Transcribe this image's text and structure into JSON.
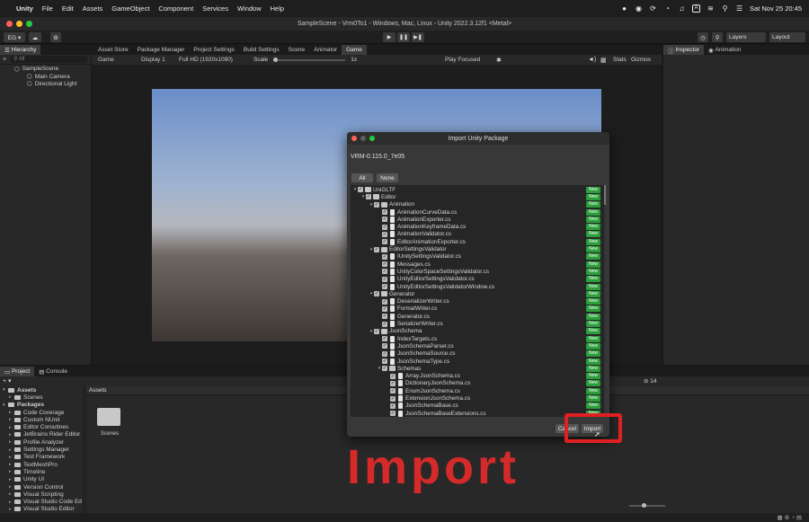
{
  "menubar": {
    "apple": "",
    "items": [
      "Unity",
      "File",
      "Edit",
      "Assets",
      "GameObject",
      "Component",
      "Services",
      "Window",
      "Help"
    ],
    "status_box_label": "A",
    "datetime": "Sat Nov 25  20:45"
  },
  "window": {
    "title": "SampleScene - Vrm0To1 - Windows, Mac, Linux - Unity 2022.3.12f1 <Metal>"
  },
  "toolbar": {
    "account": "EG ▾",
    "layers": "Layers",
    "layout": "Layout"
  },
  "hierarchy": {
    "tab": "Hierarchy",
    "search": "All",
    "scene": "SampleScene",
    "objects": [
      "Main Camera",
      "Directional Light"
    ]
  },
  "center_tabs": [
    "Asset Store",
    "Package Manager",
    "Project Settings",
    "Build Settings",
    "Scene",
    "Animator",
    "Game"
  ],
  "game_bar": {
    "mode": "Game",
    "display": "Display 1",
    "resolution": "Full HD (1920x1080)",
    "scale_label": "Scale",
    "scale_value": "1x",
    "play_mode": "Play Focused",
    "stats": "Stats",
    "gizmos": "Gizmos"
  },
  "right_tabs": [
    "Inspector",
    "Animation"
  ],
  "project": {
    "tabs": [
      "Project",
      "Console"
    ],
    "tree": [
      {
        "label": "Assets",
        "level": 0,
        "bold": true,
        "folder": true
      },
      {
        "label": "Scenes",
        "level": 1,
        "bold": false,
        "folder": true
      },
      {
        "label": "Packages",
        "level": 0,
        "bold": true,
        "folder": true
      },
      {
        "label": "Code Coverage",
        "level": 1,
        "bold": false,
        "folder": true
      },
      {
        "label": "Custom NUnit",
        "level": 1,
        "bold": false,
        "folder": true
      },
      {
        "label": "Editor Coroutines",
        "level": 1,
        "bold": false,
        "folder": true
      },
      {
        "label": "JetBrains Rider Editor",
        "level": 1,
        "bold": false,
        "folder": true
      },
      {
        "label": "Profile Analyzer",
        "level": 1,
        "bold": false,
        "folder": true
      },
      {
        "label": "Settings Manager",
        "level": 1,
        "bold": false,
        "folder": true
      },
      {
        "label": "Test Framework",
        "level": 1,
        "bold": false,
        "folder": true
      },
      {
        "label": "TextMeshPro",
        "level": 1,
        "bold": false,
        "folder": true
      },
      {
        "label": "Timeline",
        "level": 1,
        "bold": false,
        "folder": true
      },
      {
        "label": "Unity UI",
        "level": 1,
        "bold": false,
        "folder": true
      },
      {
        "label": "Version Control",
        "level": 1,
        "bold": false,
        "folder": true
      },
      {
        "label": "Visual Scripting",
        "level": 1,
        "bold": false,
        "folder": true
      },
      {
        "label": "Visual Studio Code Ed",
        "level": 1,
        "bold": false,
        "folder": true
      },
      {
        "label": "Visual Studio Editor",
        "level": 1,
        "bold": false,
        "folder": true
      }
    ],
    "breadcrumb": "Assets",
    "folder_item": "Scenes",
    "count": "14"
  },
  "dialog": {
    "title": "Import Unity Package",
    "package": "VRM-0.115.0_7e05",
    "all_label": "All",
    "none_label": "None",
    "new_badge": "New",
    "cancel_label": "Cancel",
    "import_label": "Import",
    "files": [
      {
        "name": "UniGLTF",
        "indent": 0,
        "folder": true,
        "expand": true
      },
      {
        "name": "Editor",
        "indent": 1,
        "folder": true,
        "expand": true
      },
      {
        "name": "Animation",
        "indent": 2,
        "folder": true,
        "expand": true
      },
      {
        "name": "AnimationCurveData.cs",
        "indent": 3,
        "folder": false,
        "expand": false
      },
      {
        "name": "AnimationExporter.cs",
        "indent": 3,
        "folder": false,
        "expand": false
      },
      {
        "name": "AnimationKeyframeData.cs",
        "indent": 3,
        "folder": false,
        "expand": false
      },
      {
        "name": "AnimationValidator.cs",
        "indent": 3,
        "folder": false,
        "expand": false
      },
      {
        "name": "EditorAnimationExporter.cs",
        "indent": 3,
        "folder": false,
        "expand": false
      },
      {
        "name": "EditorSettingsValidator",
        "indent": 2,
        "folder": true,
        "expand": true
      },
      {
        "name": "IUnitySettingsValidator.cs",
        "indent": 3,
        "folder": false,
        "expand": false
      },
      {
        "name": "Messages.cs",
        "indent": 3,
        "folder": false,
        "expand": false
      },
      {
        "name": "UnityColorSpaceSettingsValidator.cs",
        "indent": 3,
        "folder": false,
        "expand": false
      },
      {
        "name": "UnityEditorSettingsValidator.cs",
        "indent": 3,
        "folder": false,
        "expand": false
      },
      {
        "name": "UnityEditorSettingsValidatorWindow.cs",
        "indent": 3,
        "folder": false,
        "expand": false
      },
      {
        "name": "Generator",
        "indent": 2,
        "folder": true,
        "expand": true
      },
      {
        "name": "DeserializerWriter.cs",
        "indent": 3,
        "folder": false,
        "expand": false
      },
      {
        "name": "FormatWriter.cs",
        "indent": 3,
        "folder": false,
        "expand": false
      },
      {
        "name": "Generator.cs",
        "indent": 3,
        "folder": false,
        "expand": false
      },
      {
        "name": "SerializerWriter.cs",
        "indent": 3,
        "folder": false,
        "expand": false
      },
      {
        "name": "JsonSchema",
        "indent": 2,
        "folder": true,
        "expand": true
      },
      {
        "name": "IndexTargets.cs",
        "indent": 3,
        "folder": false,
        "expand": false
      },
      {
        "name": "JsonSchemaParser.cs",
        "indent": 3,
        "folder": false,
        "expand": false
      },
      {
        "name": "JsonSchemaSource.cs",
        "indent": 3,
        "folder": false,
        "expand": false
      },
      {
        "name": "JsonSchemaType.cs",
        "indent": 3,
        "folder": false,
        "expand": false
      },
      {
        "name": "Schemas",
        "indent": 3,
        "folder": true,
        "expand": true
      },
      {
        "name": "Array.JsonSchema.cs",
        "indent": 4,
        "folder": false,
        "expand": false
      },
      {
        "name": "DictionaryJsonSchema.cs",
        "indent": 4,
        "folder": false,
        "expand": false
      },
      {
        "name": "EnumJsonSchema.cs",
        "indent": 4,
        "folder": false,
        "expand": false
      },
      {
        "name": "ExtensionJsonSchema.cs",
        "indent": 4,
        "folder": false,
        "expand": false
      },
      {
        "name": "JsonSchemaBase.cs",
        "indent": 4,
        "folder": false,
        "expand": false
      },
      {
        "name": "JsonSchemaBaseExtensions.cs",
        "indent": 4,
        "folder": false,
        "expand": false
      }
    ]
  },
  "overlay": {
    "caption": "Import",
    "accent": "#e02020"
  }
}
